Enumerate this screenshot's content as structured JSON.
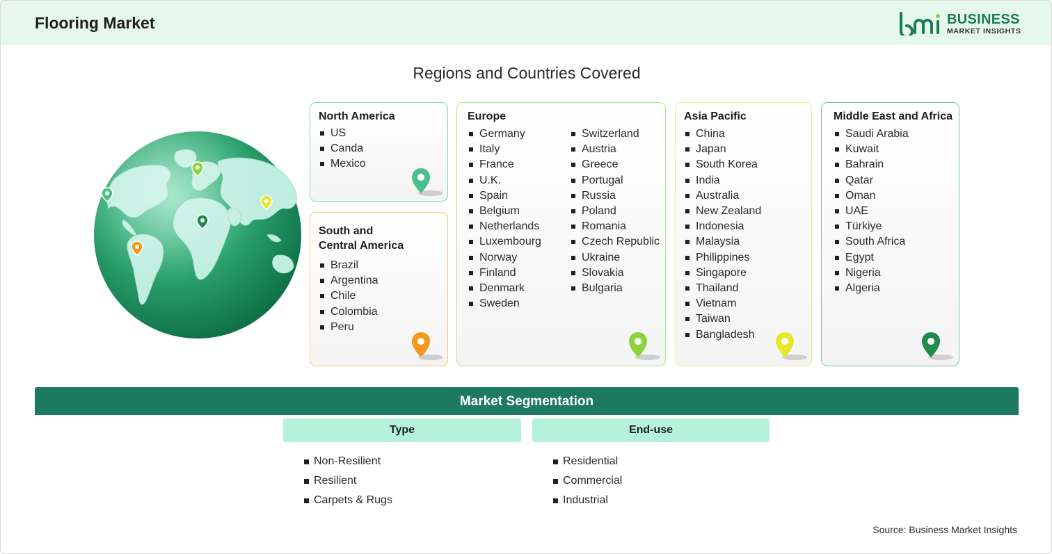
{
  "header": {
    "title": "Flooring Market",
    "logo_line1": "BUSINESS",
    "logo_line2": "MARKET INSIGHTS"
  },
  "regions_title": "Regions and Countries Covered",
  "regions": {
    "north_america": {
      "title": "North America",
      "countries": [
        "US",
        "Canda",
        "Mexico"
      ],
      "color": "#4cc08a"
    },
    "south_central_america": {
      "title_line1": "South and",
      "title_line2": "Central America",
      "countries": [
        "Brazil",
        "Argentina",
        "Chile",
        "Colombia",
        "Peru"
      ],
      "color": "#f39a1e"
    },
    "europe": {
      "title": "Europe",
      "countries_col1": [
        "Germany",
        "Italy",
        "France",
        "U.K.",
        "Spain",
        "Belgium",
        "Netherlands",
        "Luxembourg",
        "Norway",
        "Finland",
        "Denmark",
        "Sweden"
      ],
      "countries_col2": [
        "Switzerland",
        "Austria",
        "Greece",
        "Portugal",
        "Russia",
        "Poland",
        "Romania",
        "Czech Republic",
        "Ukraine",
        "Slovakia",
        "Bulgaria"
      ],
      "color": "#8cd43c"
    },
    "asia_pacific": {
      "title": "Asia Pacific",
      "countries": [
        "China",
        "Japan",
        "South Korea",
        "India",
        "Australia",
        "New Zealand",
        "Indonesia",
        "Malaysia",
        "Philippines",
        "Singapore",
        "Thailand",
        "Vietnam",
        "Taiwan",
        "Bangladesh"
      ],
      "color": "#e6e82a"
    },
    "middle_east_africa": {
      "title": "Middle East and Africa",
      "countries": [
        "Saudi Arabia",
        "Kuwait",
        "Bahrain",
        "Qatar",
        "Oman",
        "UAE",
        "Türkiye",
        "South Africa",
        "Egypt",
        "Nigeria",
        "Algeria"
      ],
      "color": "#1f8a4c"
    }
  },
  "segmentation": {
    "title": "Market Segmentation",
    "type": {
      "label": "Type",
      "items": [
        "Non-Resilient",
        "Resilient",
        "Carpets & Rugs"
      ]
    },
    "end_use": {
      "label": "End-use",
      "items": [
        "Residential",
        "Commercial",
        "Industrial"
      ]
    }
  },
  "source": "Source: Business Market Insights",
  "colors": {
    "brand_green": "#1c7a5e",
    "header_bg": "#e6f7ee",
    "segment_head_bg": "#b4f2dc"
  }
}
